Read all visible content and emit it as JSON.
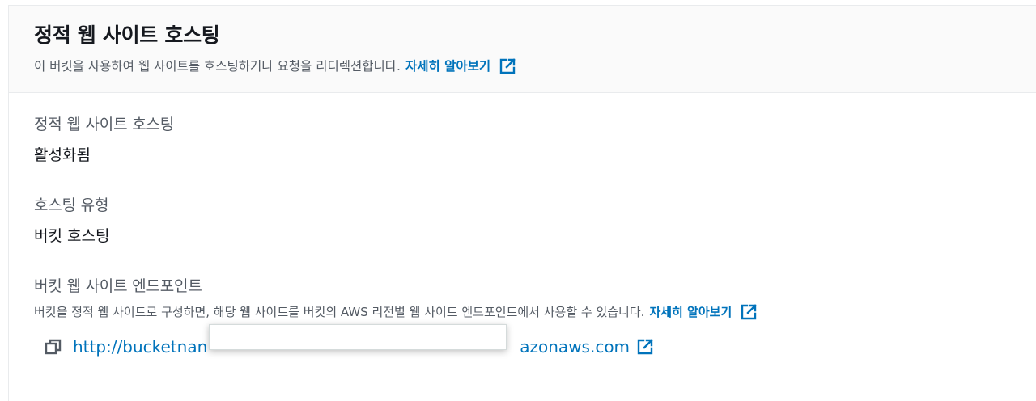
{
  "header": {
    "title": "정적 웹 사이트 호스팅",
    "description": "이 버킷을 사용하여 웹 사이트를 호스팅하거나 요청을 리디렉션합니다.",
    "learn_more": "자세히 알아보기"
  },
  "fields": {
    "hosting": {
      "label": "정적 웹 사이트 호스팅",
      "value": "활성화됨"
    },
    "hosting_type": {
      "label": "호스팅 유형",
      "value": "버킷 호스팅"
    },
    "endpoint": {
      "label": "버킷 웹 사이트 엔드포인트",
      "description": "버킷을 정적 웹 사이트로 구성하면, 해당 웹 사이트를 버킷의 AWS 리전별 웹 사이트 엔드포인트에서 사용할 수 있습니다.",
      "learn_more": "자세히 알아보기",
      "url_visible_start": "http://bucketnan",
      "url_visible_end": "azonaws.com"
    }
  },
  "icons": {
    "external": "external-link-icon",
    "copy": "copy-icon"
  },
  "colors": {
    "link": "#0073bb",
    "text": "#16191f",
    "secondary": "#545b64",
    "header_bg": "#fafafa"
  }
}
